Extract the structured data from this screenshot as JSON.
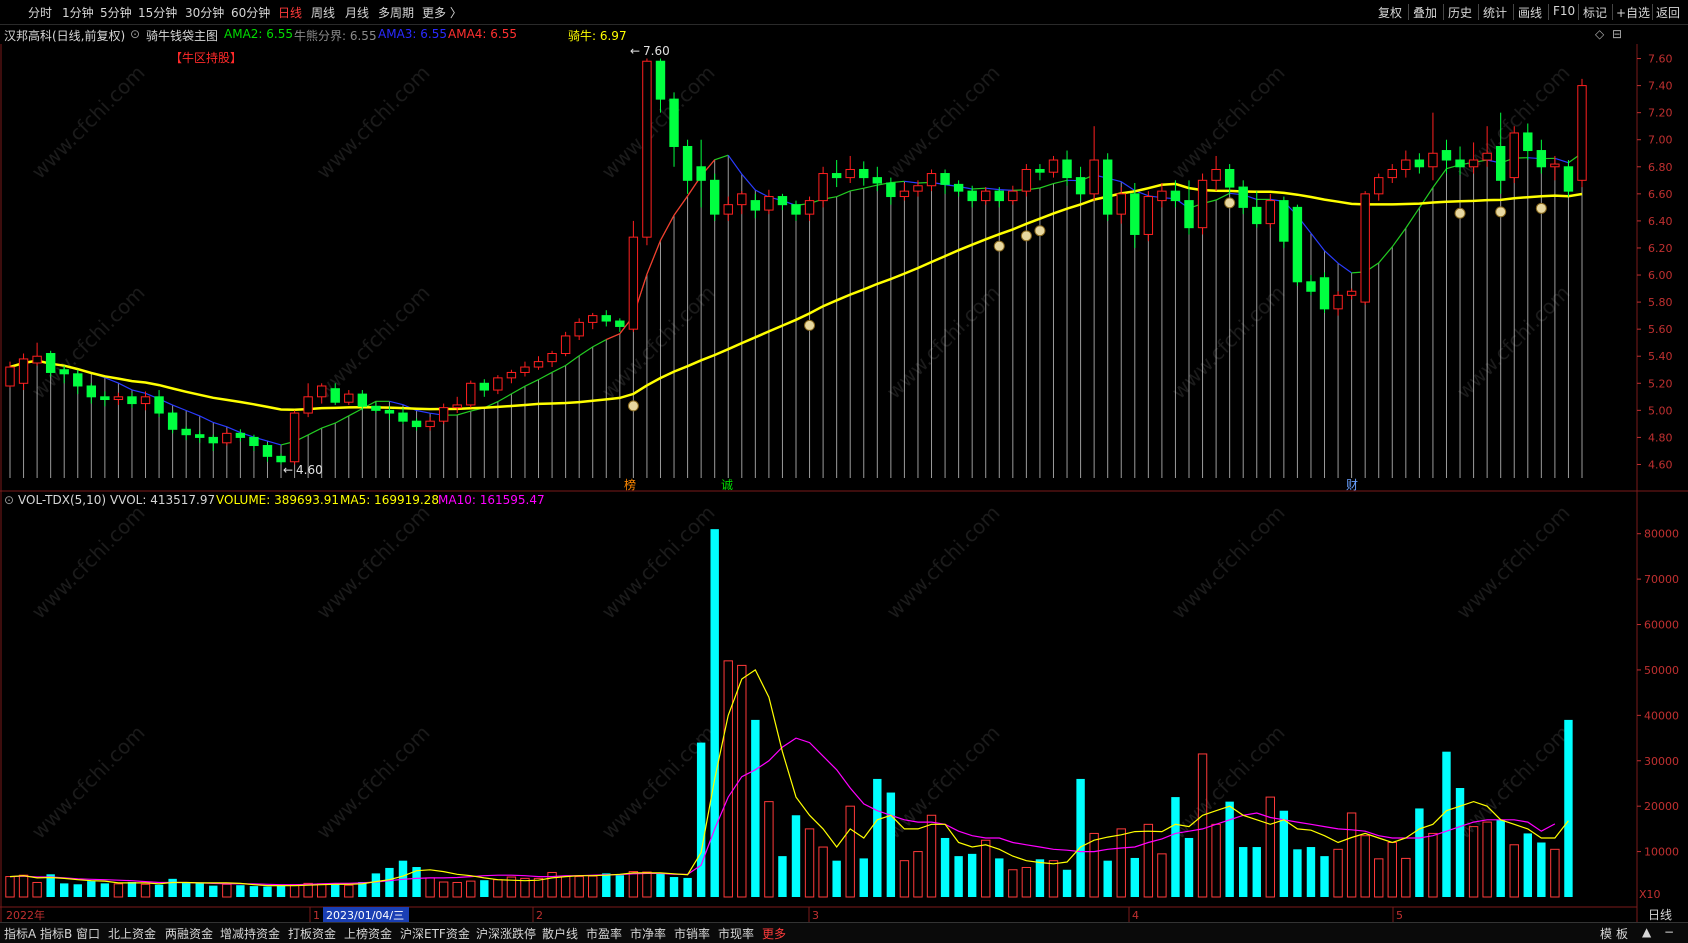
{
  "toolbar": {
    "periods": [
      "分时",
      "1分钟",
      "5分钟",
      "15分钟",
      "30分钟",
      "60分钟",
      "日线",
      "周线",
      "月线",
      "多周期",
      "更多 〉"
    ],
    "active_period": "日线",
    "right_buttons": [
      "复权",
      "叠加",
      "历史",
      "统计",
      "画线",
      "F10",
      "标记",
      "+自选",
      "返回"
    ]
  },
  "info": {
    "stock": "汉邦高科(日线,前复权)",
    "indicator": "骑牛钱袋主图",
    "ama2": "AMA2: 6.55",
    "bull_line": "牛熊分界: 6.55",
    "ama3": "AMA3: 6.55",
    "ama4": "AMA4: 6.55",
    "rider": "骑牛: 6.97",
    "bull_zone": "【牛区持股】",
    "colors": {
      "ama2": "#00dd00",
      "bull_line": "#888888",
      "ama3": "#2a2aff",
      "ama4": "#ff3030",
      "rider": "#ffff00",
      "bull_zone": "#ff2a2a"
    }
  },
  "volume_info": {
    "name": "VOL-TDX(5,10)",
    "vvol": "VVOL: 413517.97",
    "volume": "VOLUME: 389693.91",
    "ma5": "MA5: 169919.28",
    "ma10": "MA10: 161595.47",
    "colors": {
      "volume": "#ffff00",
      "ma5": "#ffff00",
      "ma10": "#ff00ff"
    }
  },
  "chart_data": [
    {
      "type": "candlestick",
      "title": "汉邦高科(日线,前复权)",
      "ylim": [
        4.5,
        7.7
      ],
      "y_ticks": [
        "7.60",
        "7.40",
        "7.20",
        "7.00",
        "6.80",
        "6.60",
        "6.40",
        "6.20",
        "6.00",
        "5.80",
        "5.60",
        "5.40",
        "5.20",
        "5.00",
        "4.80",
        "4.60"
      ],
      "annotations": {
        "high_label": "7.60",
        "low_label": "4.60",
        "bang": "榜",
        "cheng": "诚",
        "cai": "财"
      },
      "ohlc": [
        [
          5.18,
          5.32,
          5.17,
          5.36
        ],
        [
          5.2,
          5.38,
          5.15,
          5.42
        ],
        [
          5.35,
          5.4,
          5.33,
          5.5
        ],
        [
          5.42,
          5.28,
          5.25,
          5.44
        ],
        [
          5.3,
          5.27,
          5.2,
          5.33
        ],
        [
          5.27,
          5.18,
          5.12,
          5.3
        ],
        [
          5.18,
          5.1,
          5.05,
          5.2
        ],
        [
          5.1,
          5.08,
          5.03,
          5.14
        ],
        [
          5.08,
          5.1,
          5.04,
          5.13
        ],
        [
          5.1,
          5.05,
          5.02,
          5.13
        ],
        [
          5.05,
          5.1,
          5.0,
          5.14
        ],
        [
          5.1,
          4.98,
          4.95,
          5.15
        ],
        [
          4.98,
          4.86,
          4.83,
          5.0
        ],
        [
          4.86,
          4.82,
          4.78,
          4.88
        ],
        [
          4.82,
          4.8,
          4.76,
          4.85
        ],
        [
          4.8,
          4.76,
          4.7,
          4.82
        ],
        [
          4.76,
          4.83,
          4.74,
          4.86
        ],
        [
          4.83,
          4.8,
          4.77,
          4.86
        ],
        [
          4.8,
          4.74,
          4.7,
          4.82
        ],
        [
          4.74,
          4.66,
          4.62,
          4.76
        ],
        [
          4.66,
          4.62,
          4.6,
          4.68
        ],
        [
          4.62,
          4.98,
          4.6,
          5.0
        ],
        [
          4.98,
          5.1,
          4.95,
          5.2
        ],
        [
          5.1,
          5.18,
          5.05,
          5.2
        ],
        [
          5.16,
          5.06,
          5.04,
          5.2
        ],
        [
          5.06,
          5.12,
          5.04,
          5.15
        ],
        [
          5.12,
          5.03,
          5.0,
          5.15
        ],
        [
          5.03,
          5.0,
          4.98,
          5.06
        ],
        [
          5.0,
          4.98,
          4.93,
          5.03
        ],
        [
          4.98,
          4.92,
          4.9,
          5.02
        ],
        [
          4.92,
          4.88,
          4.85,
          4.94
        ],
        [
          4.88,
          4.92,
          4.85,
          4.95
        ],
        [
          4.92,
          5.02,
          4.9,
          5.05
        ],
        [
          5.02,
          5.04,
          4.98,
          5.1
        ],
        [
          5.04,
          5.2,
          5.02,
          5.22
        ],
        [
          5.2,
          5.15,
          5.1,
          5.23
        ],
        [
          5.15,
          5.24,
          5.12,
          5.26
        ],
        [
          5.24,
          5.28,
          5.2,
          5.3
        ],
        [
          5.28,
          5.32,
          5.25,
          5.36
        ],
        [
          5.32,
          5.36,
          5.3,
          5.4
        ],
        [
          5.36,
          5.42,
          5.32,
          5.44
        ],
        [
          5.42,
          5.55,
          5.4,
          5.58
        ],
        [
          5.55,
          5.65,
          5.52,
          5.68
        ],
        [
          5.65,
          5.7,
          5.6,
          5.72
        ],
        [
          5.7,
          5.66,
          5.62,
          5.74
        ],
        [
          5.66,
          5.62,
          5.58,
          5.68
        ],
        [
          5.6,
          6.28,
          5.58,
          6.4
        ],
        [
          6.28,
          7.58,
          6.22,
          7.6
        ],
        [
          7.58,
          7.3,
          7.2,
          7.6
        ],
        [
          7.3,
          6.95,
          6.8,
          7.35
        ],
        [
          6.95,
          6.7,
          6.6,
          7.0
        ],
        [
          6.8,
          6.7,
          6.5,
          7.0
        ],
        [
          6.7,
          6.45,
          6.4,
          6.75
        ],
        [
          6.45,
          6.52,
          6.4,
          6.58
        ],
        [
          6.52,
          6.6,
          6.45,
          6.62
        ],
        [
          6.55,
          6.48,
          6.42,
          6.6
        ],
        [
          6.48,
          6.58,
          6.45,
          6.63
        ],
        [
          6.58,
          6.52,
          6.48,
          6.6
        ],
        [
          6.52,
          6.45,
          6.4,
          6.55
        ],
        [
          6.45,
          6.55,
          6.4,
          6.58
        ],
        [
          6.55,
          6.75,
          6.5,
          6.8
        ],
        [
          6.75,
          6.72,
          6.65,
          6.85
        ],
        [
          6.72,
          6.78,
          6.68,
          6.88
        ],
        [
          6.78,
          6.72,
          6.66,
          6.84
        ],
        [
          6.72,
          6.68,
          6.62,
          6.8
        ],
        [
          6.68,
          6.58,
          6.52,
          6.72
        ],
        [
          6.58,
          6.62,
          6.55,
          6.68
        ],
        [
          6.62,
          6.66,
          6.58,
          6.7
        ],
        [
          6.66,
          6.75,
          6.62,
          6.78
        ],
        [
          6.75,
          6.67,
          6.6,
          6.78
        ],
        [
          6.67,
          6.62,
          6.58,
          6.7
        ],
        [
          6.62,
          6.55,
          6.5,
          6.66
        ],
        [
          6.55,
          6.62,
          6.52,
          6.65
        ],
        [
          6.62,
          6.55,
          6.5,
          6.65
        ],
        [
          6.55,
          6.62,
          6.52,
          6.66
        ],
        [
          6.62,
          6.78,
          6.58,
          6.82
        ],
        [
          6.78,
          6.76,
          6.7,
          6.82
        ],
        [
          6.76,
          6.85,
          6.72,
          6.88
        ],
        [
          6.85,
          6.72,
          6.66,
          6.92
        ],
        [
          6.72,
          6.6,
          6.55,
          6.8
        ],
        [
          6.6,
          6.85,
          6.55,
          7.1
        ],
        [
          6.85,
          6.45,
          6.4,
          6.9
        ],
        [
          6.45,
          6.6,
          6.38,
          6.65
        ],
        [
          6.6,
          6.3,
          6.2,
          6.68
        ],
        [
          6.3,
          6.58,
          6.25,
          6.62
        ],
        [
          6.55,
          6.62,
          6.5,
          6.68
        ],
        [
          6.62,
          6.55,
          6.5,
          6.7
        ],
        [
          6.55,
          6.35,
          6.3,
          6.7
        ],
        [
          6.35,
          6.7,
          6.3,
          6.75
        ],
        [
          6.7,
          6.78,
          6.62,
          6.88
        ],
        [
          6.78,
          6.65,
          6.6,
          6.82
        ],
        [
          6.65,
          6.5,
          6.45,
          6.7
        ],
        [
          6.5,
          6.38,
          6.35,
          6.62
        ],
        [
          6.38,
          6.55,
          6.35,
          6.6
        ],
        [
          6.55,
          6.25,
          6.2,
          6.58
        ],
        [
          6.5,
          5.95,
          5.92,
          6.52
        ],
        [
          5.95,
          5.88,
          5.85,
          6.0
        ],
        [
          5.98,
          5.75,
          5.72,
          6.02
        ],
        [
          5.75,
          5.85,
          5.7,
          5.88
        ],
        [
          5.85,
          5.88,
          5.82,
          5.9
        ],
        [
          5.8,
          6.6,
          5.78,
          6.62
        ],
        [
          6.6,
          6.72,
          6.55,
          6.75
        ],
        [
          6.72,
          6.78,
          6.68,
          6.82
        ],
        [
          6.78,
          6.85,
          6.72,
          6.92
        ],
        [
          6.85,
          6.8,
          6.75,
          6.9
        ],
        [
          6.8,
          6.9,
          6.7,
          7.2
        ],
        [
          6.92,
          6.85,
          6.75,
          7.0
        ],
        [
          6.85,
          6.8,
          6.74,
          6.95
        ],
        [
          6.8,
          6.85,
          6.75,
          6.98
        ],
        [
          6.85,
          6.9,
          6.8,
          7.1
        ],
        [
          6.95,
          6.7,
          6.6,
          7.2
        ],
        [
          6.72,
          7.05,
          6.68,
          7.1
        ],
        [
          7.05,
          6.92,
          6.85,
          7.12
        ],
        [
          6.92,
          6.8,
          6.75,
          7.0
        ],
        [
          6.8,
          6.82,
          6.7,
          6.88
        ],
        [
          6.8,
          6.62,
          6.58,
          6.85
        ],
        [
          6.7,
          7.4,
          6.65,
          7.45
        ]
      ]
    },
    {
      "type": "bar",
      "title": "VOL-TDX(5,10)",
      "ylim": [
        0,
        85000
      ],
      "y_ticks": [
        "80000",
        "70000",
        "60000",
        "50000",
        "40000",
        "30000",
        "20000",
        "10000"
      ],
      "unit_label": "X10",
      "values": [
        4500,
        4800,
        3200,
        5000,
        3000,
        2800,
        3500,
        3000,
        2900,
        3300,
        2800,
        2700,
        4000,
        3200,
        3000,
        2500,
        2800,
        2600,
        2400,
        2300,
        2600,
        2700,
        3000,
        2900,
        2800,
        2600,
        3300,
        5200,
        6400,
        8000,
        6600,
        4200,
        3300,
        3200,
        3500,
        3700,
        3800,
        4400,
        4100,
        4100,
        5400,
        4600,
        4500,
        4600,
        5200,
        4800,
        5600,
        5500,
        5200,
        4400,
        4200,
        34000,
        81000,
        52000,
        51000,
        39000,
        21000,
        9000,
        18000,
        15000,
        11000,
        8000,
        20000,
        8500,
        26000,
        23000,
        8000,
        10000,
        18000,
        13000,
        9000,
        9500,
        12500,
        8500,
        6000,
        6500,
        8300,
        8000,
        6000,
        26000,
        14000,
        8000,
        15000,
        8600,
        16000,
        9500,
        22000,
        13000,
        31500,
        16000,
        21000,
        11000,
        11000,
        22000,
        19000,
        10500,
        11000,
        9000,
        10500,
        18500,
        13500,
        8400,
        12000,
        8500,
        19500,
        14000,
        32000,
        24000,
        15500,
        16500,
        17000,
        11500,
        14000,
        12000,
        10500,
        39000
      ],
      "ma5": [
        4500,
        4700,
        4200,
        4300,
        4100,
        3800,
        3600,
        3500,
        3100,
        3100,
        3100,
        2900,
        3200,
        3200,
        3100,
        3100,
        3100,
        3000,
        2700,
        2500,
        2500,
        2500,
        2600,
        2700,
        2800,
        2800,
        2900,
        3400,
        3800,
        4600,
        5800,
        6000,
        5600,
        5000,
        4700,
        4200,
        3800,
        3700,
        3600,
        3700,
        4200,
        4500,
        4700,
        4700,
        4800,
        5000,
        5300,
        5300,
        5300,
        5100,
        4900,
        9800,
        26000,
        40000,
        48000,
        50000,
        44000,
        32000,
        22000,
        18000,
        15000,
        11000,
        15000,
        13000,
        17000,
        18000,
        15000,
        15000,
        16000,
        16000,
        12000,
        11000,
        11500,
        10500,
        9000,
        8000,
        7600,
        7300,
        7700,
        11000,
        12500,
        13200,
        13700,
        14400,
        14500,
        14400,
        16000,
        15500,
        18000,
        19000,
        20000,
        18000,
        17000,
        16000,
        17000,
        15000,
        14700,
        13500,
        12000,
        13100,
        14000,
        13000,
        12000,
        13000,
        15000,
        16000,
        19000,
        20000,
        21000,
        20000,
        17000,
        16000,
        15000,
        13000,
        13000,
        16800
      ],
      "ma10": [
        4500,
        4600,
        4400,
        4400,
        4200,
        4000,
        3900,
        3800,
        3700,
        3600,
        3400,
        3200,
        3200,
        3200,
        3100,
        3000,
        2900,
        2900,
        2900,
        2800,
        2700,
        2700,
        2800,
        2900,
        3000,
        3000,
        3100,
        3300,
        3600,
        3900,
        4100,
        4200,
        4200,
        4300,
        4500,
        4700,
        4800,
        4800,
        4700,
        4500,
        4500,
        4700,
        4700,
        4800,
        4900,
        4900,
        5100,
        5200,
        5200,
        5000,
        5000,
        7000,
        15000,
        22000,
        26500,
        28000,
        30000,
        33000,
        35000,
        34000,
        31000,
        28000,
        24000,
        20500,
        19000,
        18000,
        17000,
        16500,
        16500,
        16000,
        14500,
        13500,
        13000,
        13000,
        12000,
        11500,
        11000,
        10500,
        10300,
        10000,
        10000,
        10500,
        10800,
        11000,
        12000,
        12800,
        14000,
        14500,
        15000,
        16000,
        17000,
        18000,
        18500,
        17500,
        17000,
        16500,
        16000,
        15500,
        15000,
        14800,
        14500,
        13500,
        13000,
        13000,
        13000,
        13500,
        14500,
        15500,
        16500,
        17000,
        17000,
        17000,
        16500,
        14500,
        16100
      ]
    }
  ],
  "bottom": {
    "tabs": [
      "指标A",
      "指标B",
      "窗口",
      "北上资金",
      "两融资金",
      "增减持资金",
      "打板资金",
      "上榜资金",
      "沪深ETF资金",
      "沪深涨跌停",
      "散户线",
      "市盈率",
      "市净率",
      "市销率",
      "市现率",
      "更多"
    ],
    "red_tab": "更多",
    "right": [
      "模",
      "板",
      "▲",
      "−"
    ],
    "timeline": [
      "2022年",
      "1",
      "2023/01/04/三",
      "2",
      "3",
      "4",
      "5",
      "日线"
    ]
  },
  "watermark": "www.cfchi.com"
}
